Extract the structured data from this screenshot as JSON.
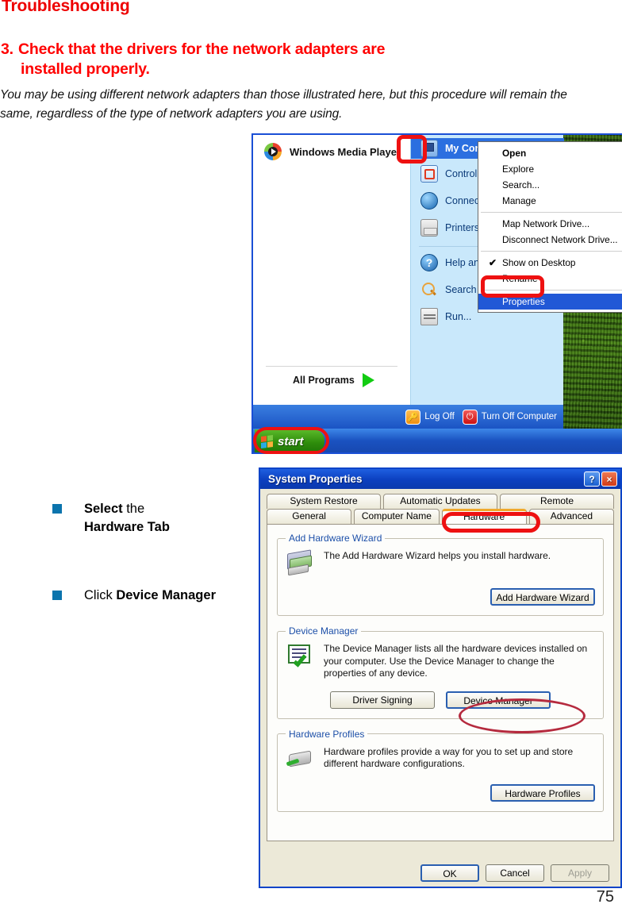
{
  "document": {
    "title": "Troubleshooting",
    "step_number": "3.",
    "step_title_line1": "Check that the drivers for the network adapters are",
    "step_title_line2": "installed properly.",
    "paragraph": "You may be using different network adapters than those illustrated here, but this procedure will remain the same, regardless of the type of network adapters you are using.",
    "page_number": "75",
    "accent_red": "#ff0000",
    "bullet_color": "#0b74ad"
  },
  "instructions": [
    {
      "prefix": "Select",
      "middle": " the ",
      "bold_rest": "Hardware Tab",
      "plain_lead": "",
      "full": "Select the Hardware Tab"
    },
    {
      "prefix": "Click",
      "middle": " ",
      "bold_rest": "Device Manager",
      "plain_lead": "Click ",
      "full": "Click Device Manager"
    }
  ],
  "start_menu": {
    "pinned_app": "Windows Media Player",
    "all_programs": "All Programs",
    "right_items": [
      {
        "label": "My Computer",
        "icon": "my-computer-icon",
        "selected": true
      },
      {
        "label": "Control Panel",
        "icon": "control-panel-icon",
        "selected": false
      },
      {
        "label": "Connect To",
        "icon": "connect-to-icon",
        "selected": false
      },
      {
        "label": "Printers and Faxes",
        "icon": "printers-icon",
        "selected": false
      },
      {
        "label": "Help and Support",
        "icon": "help-icon",
        "selected": false
      },
      {
        "label": "Search",
        "icon": "search-icon",
        "selected": false
      },
      {
        "label": "Run...",
        "icon": "run-icon",
        "selected": false
      }
    ],
    "log_off": "Log Off",
    "turn_off": "Turn Off Computer",
    "start_button": "start",
    "context_menu": [
      {
        "label": "Open",
        "bold": true,
        "selected": false,
        "check": false
      },
      {
        "label": "Explore",
        "bold": false,
        "selected": false,
        "check": false
      },
      {
        "label": "Search...",
        "bold": false,
        "selected": false,
        "check": false
      },
      {
        "label": "Manage",
        "bold": false,
        "selected": false,
        "check": false
      },
      {
        "separator": true
      },
      {
        "label": "Map Network Drive...",
        "bold": false,
        "selected": false,
        "check": false
      },
      {
        "label": "Disconnect Network Drive...",
        "bold": false,
        "selected": false,
        "check": false
      },
      {
        "separator": true
      },
      {
        "label": "Show on Desktop",
        "bold": false,
        "selected": false,
        "check": true
      },
      {
        "label": "Rename",
        "bold": false,
        "selected": false,
        "check": false
      },
      {
        "separator": true
      },
      {
        "label": "Properties",
        "bold": false,
        "selected": true,
        "check": false
      }
    ]
  },
  "system_properties": {
    "window_title": "System Properties",
    "help_button": "?",
    "close_button": "×",
    "tabs_row1": [
      "System Restore",
      "Automatic Updates",
      "Remote"
    ],
    "tabs_row2": [
      "General",
      "Computer Name",
      "Hardware",
      "Advanced"
    ],
    "active_tab": "Hardware",
    "groups": [
      {
        "legend": "Add Hardware Wizard",
        "icon": "add-hardware-icon",
        "text": "The Add Hardware Wizard helps you install hardware.",
        "buttons": [
          "Add Hardware Wizard"
        ]
      },
      {
        "legend": "Device Manager",
        "icon": "device-manager-icon",
        "text": "The Device Manager lists all the hardware devices installed on your computer. Use the Device Manager to change the properties of any device.",
        "buttons": [
          "Driver Signing",
          "Device Manager"
        ]
      },
      {
        "legend": "Hardware Profiles",
        "icon": "hardware-profiles-icon",
        "text": "Hardware profiles provide a way for you to set up and store different hardware configurations.",
        "buttons": [
          "Hardware Profiles"
        ]
      }
    ],
    "footer_buttons": [
      {
        "label": "OK",
        "state": "default"
      },
      {
        "label": "Cancel",
        "state": "normal"
      },
      {
        "label": "Apply",
        "state": "disabled"
      }
    ]
  },
  "annotations": {
    "highlight_red": "#ee1111",
    "ellipse_red": "#b52a3e"
  }
}
